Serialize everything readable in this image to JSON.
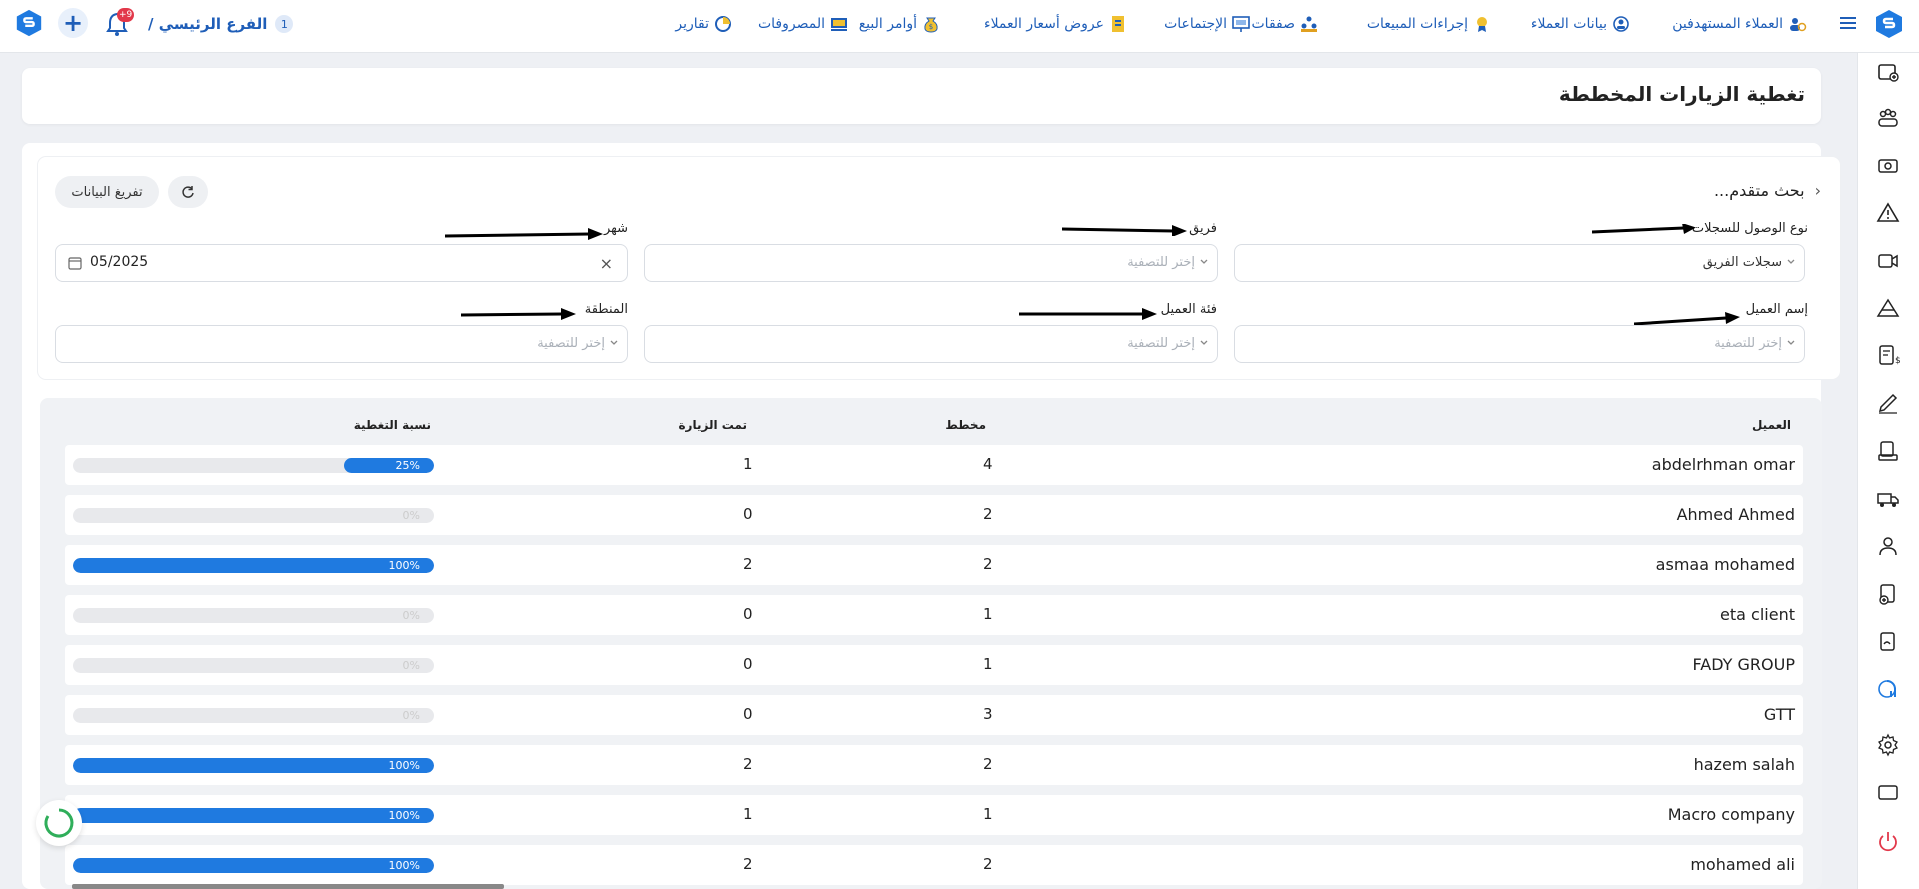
{
  "topbar": {
    "branch_count": "1",
    "branch_name": "الفرع الرئيسي /",
    "notifications_badge": "+9",
    "nav": [
      {
        "label": "العملاء المستهدفين",
        "icon": "target-customers-icon"
      },
      {
        "label": "بيانات العملاء",
        "icon": "customer-data-icon"
      },
      {
        "label": "إجراءات المبيعات",
        "icon": "sales-actions-icon"
      },
      {
        "label": "صفقات",
        "icon": "deals-icon"
      },
      {
        "label": "الإجتماعات",
        "icon": "meetings-icon"
      },
      {
        "label": "عروض أسعار العملاء",
        "icon": "quotations-icon"
      },
      {
        "label": "أوامر البيع",
        "icon": "sales-orders-icon"
      },
      {
        "label": "المصروفات",
        "icon": "expenses-icon"
      },
      {
        "label": "تقارير",
        "icon": "reports-icon"
      }
    ]
  },
  "page": {
    "title": "تغطية الزيارات المخططة"
  },
  "filters": {
    "advanced_search": "بحث متقدم...",
    "export_label": "تفريغ البيانات",
    "access_type": {
      "label": "نوع الوصول للسجلات",
      "value": "سجلات الفريق"
    },
    "team": {
      "label": "فريق",
      "placeholder": "إختر للتصفية"
    },
    "month": {
      "label": "شهر",
      "value": "05/2025"
    },
    "customer_name": {
      "label": "إسم العميل",
      "placeholder": "إختر للتصفية"
    },
    "customer_category": {
      "label": "فئة العميل",
      "placeholder": "إختر للتصفية"
    },
    "region": {
      "label": "المنطقة",
      "placeholder": "إختر للتصفية"
    }
  },
  "table": {
    "headers": {
      "customer": "العميل",
      "planned": "مخطط",
      "visited": "تمت الزيارة",
      "coverage": "نسبة التغطية"
    },
    "rows": [
      {
        "customer": "abdelrhman omar",
        "planned": "4",
        "visited": "1",
        "coverage_label": "25%",
        "coverage": 25
      },
      {
        "customer": "Ahmed Ahmed",
        "planned": "2",
        "visited": "0",
        "coverage_label": "0%",
        "coverage": 0
      },
      {
        "customer": "asmaa mohamed",
        "planned": "2",
        "visited": "2",
        "coverage_label": "100%",
        "coverage": 100
      },
      {
        "customer": "eta client",
        "planned": "1",
        "visited": "0",
        "coverage_label": "0%",
        "coverage": 0
      },
      {
        "customer": "FADY GROUP",
        "planned": "1",
        "visited": "0",
        "coverage_label": "0%",
        "coverage": 0
      },
      {
        "customer": "GTT",
        "planned": "3",
        "visited": "0",
        "coverage_label": "0%",
        "coverage": 0
      },
      {
        "customer": "hazem salah",
        "planned": "2",
        "visited": "2",
        "coverage_label": "100%",
        "coverage": 100
      },
      {
        "customer": "Macro company",
        "planned": "1",
        "visited": "1",
        "coverage_label": "100%",
        "coverage": 100
      },
      {
        "customer": "mohamed ali",
        "planned": "2",
        "visited": "2",
        "coverage_label": "100%",
        "coverage": 100
      }
    ]
  },
  "colors": {
    "brand": "#1f5eb8",
    "progress": "#1f7ae0",
    "badge": "#e2384a"
  }
}
